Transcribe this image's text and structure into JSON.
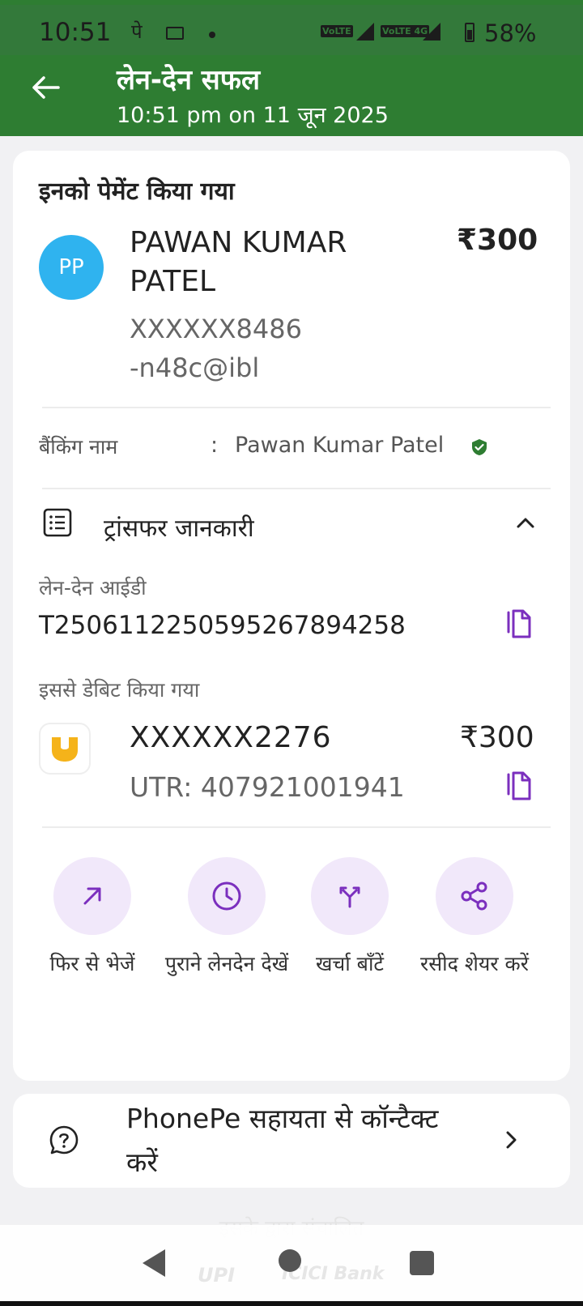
{
  "status_bar": {
    "time": "10:51",
    "app_glyph": "पे",
    "battery": "58%",
    "network": [
      "VoLTE",
      "VoLTE 4G"
    ]
  },
  "header": {
    "title": "लेन-देन सफल",
    "subtitle": "10:51 pm on 11 जून 2025",
    "background_color": "#2e7d32"
  },
  "payment": {
    "heading": "इनको पेमेंट किया गया",
    "avatar_initials": "PP",
    "avatar_color": "#2fb3ef",
    "payee_name": "PAWAN KUMAR PATEL",
    "amount": "₹300",
    "payee_account": "XXXXXX8486",
    "payee_vpa": "-n48c@ibl"
  },
  "banking": {
    "label": "बैंकिंग नाम",
    "separator": ":",
    "name": "Pawan Kumar Patel",
    "verified_icon": "verified-shield-icon"
  },
  "transfer": {
    "title": "ट्रांसफर जानकारी",
    "txn_label": "लेन-देन आईडी",
    "txn_id": "T2506112250595267894258",
    "debit_label": "इससे डेबिट किया गया",
    "debit_account": "XXXXXX2276",
    "debit_amount": "₹300",
    "utr": "UTR: 407921001941"
  },
  "actions": [
    {
      "label": "फिर से भेजें",
      "icon": "arrow-up-right-icon"
    },
    {
      "label": "पुराने लेनदेन देखें",
      "icon": "clock-icon"
    },
    {
      "label": "खर्चा बाँटें",
      "icon": "split-icon"
    },
    {
      "label": "रसीद शेयर करें",
      "icon": "share-icon"
    }
  ],
  "help": {
    "text": "PhonePe सहायता से कॉन्टैक्ट करें"
  },
  "footer": {
    "powered_by": "इसके द्वारा संचालित",
    "partner_1": "UPI",
    "partner_2": "ICICI Bank"
  },
  "accent_color": "#7b2fbe"
}
